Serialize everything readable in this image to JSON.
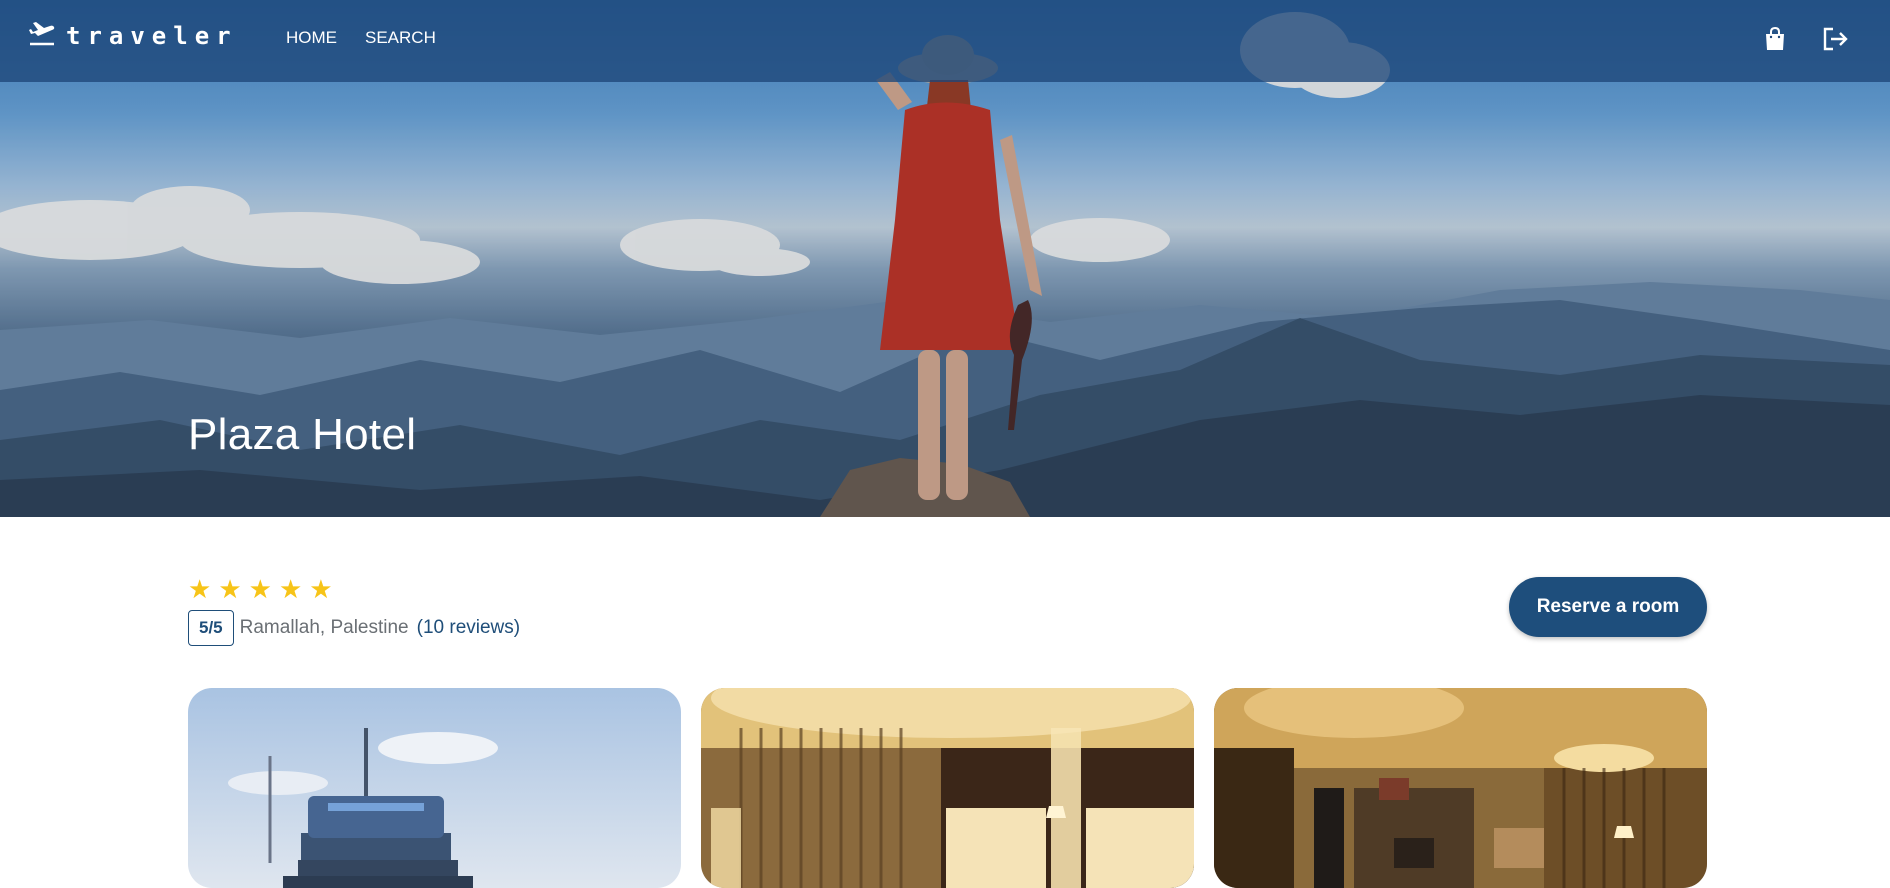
{
  "brand": {
    "name": "traveler",
    "icon": "airplane-departure-icon"
  },
  "nav": {
    "links": [
      {
        "label": "HOME"
      },
      {
        "label": "SEARCH"
      }
    ],
    "icons": [
      {
        "name": "shopping-bag-icon"
      },
      {
        "name": "logout-icon"
      }
    ]
  },
  "hero": {
    "title": "Plaza Hotel"
  },
  "hotel": {
    "stars": 5,
    "rating": "5/5",
    "location": "Ramallah, Palestine",
    "reviews": "(10 reviews)",
    "reserve_label": "Reserve a room"
  },
  "gallery": [
    {
      "alt": "hotel tower exterior"
    },
    {
      "alt": "hotel bedroom"
    },
    {
      "alt": "hotel suite living area"
    }
  ],
  "colors": {
    "primary": "#1e4e7c",
    "star": "#f7c418",
    "nav_bg": "#1e4678"
  }
}
